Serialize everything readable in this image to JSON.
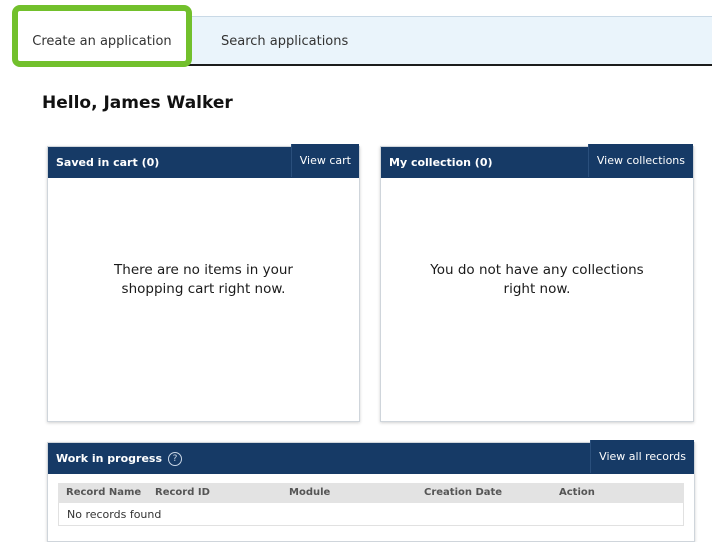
{
  "tabs": [
    {
      "label": "Create an application"
    },
    {
      "label": "Search applications"
    }
  ],
  "greeting": "Hello, James Walker",
  "cart": {
    "title": "Saved in cart (0)",
    "link": "View cart",
    "message_line1": "There are no items in your",
    "message_line2": "shopping cart right now."
  },
  "collection": {
    "title": "My collection (0)",
    "link": "View collections",
    "message_line1": "You do not have any collections",
    "message_line2": "right now."
  },
  "work": {
    "title": "Work in progress",
    "help_icon": "?",
    "link": "View all records",
    "columns": [
      "Record Name",
      "Record ID",
      "Module",
      "Creation Date",
      "Action"
    ],
    "empty": "No records found"
  },
  "colors": {
    "header_navy": "#163a66",
    "highlight_green": "#72c02c",
    "tabbar_bg": "#eaf4fb"
  }
}
